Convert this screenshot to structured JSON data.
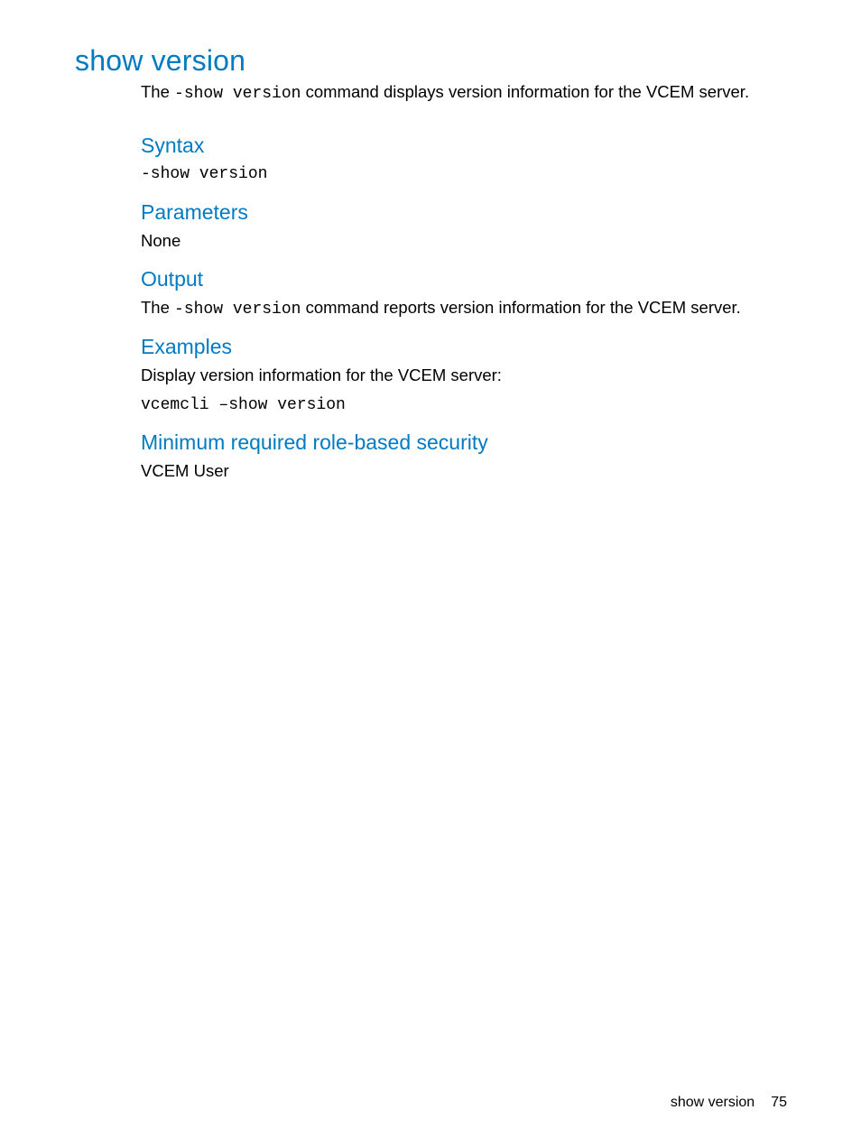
{
  "heading": "show version",
  "intro": {
    "pre": "The ",
    "code": "-show version",
    "post": " command displays version information for the VCEM server."
  },
  "syntax": {
    "title": "Syntax",
    "code": "-show version"
  },
  "parameters": {
    "title": "Parameters",
    "text": "None"
  },
  "output": {
    "title": "Output",
    "pre": "The ",
    "code": "-show version",
    "post": " command reports version information for the VCEM server."
  },
  "examples": {
    "title": "Examples",
    "text": "Display version information for the VCEM server:",
    "code": "vcemcli –show version"
  },
  "security": {
    "title": "Minimum required role-based security",
    "text": "VCEM User"
  },
  "footer": {
    "section": "show version",
    "page": "75"
  }
}
